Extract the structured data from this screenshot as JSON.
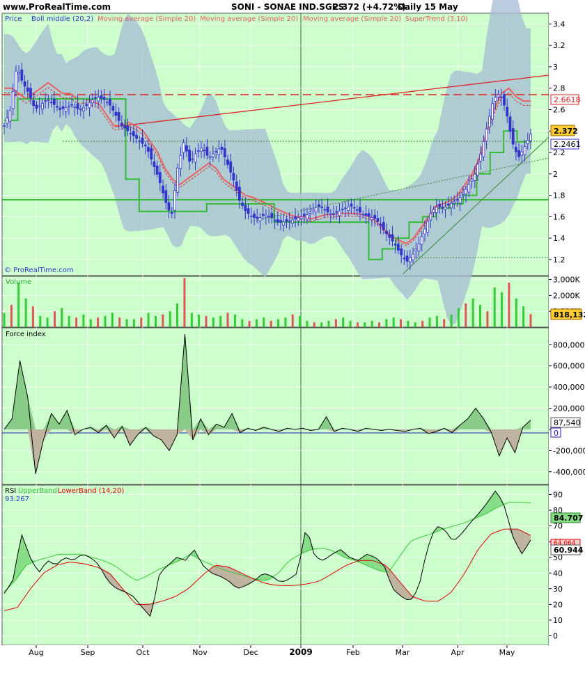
{
  "header": {
    "site": "www.ProRealTime.com",
    "instrument": "SONI - SONAE IND.SGPS",
    "quote": "2.372 (+4.72%)",
    "period": "Daily  15 May"
  },
  "colors": {
    "background": "#ccffcc",
    "price_candle": "#3333cc",
    "bollinger_band": "#a9bfd4",
    "moving_average": "#e86060",
    "supertrend": "#33bb33",
    "volume_up": "#33cc33",
    "volume_down": "#dd5555",
    "rsi_line": "#000000",
    "rsi_upper": "#33cc33",
    "rsi_lower": "#dd0000"
  },
  "price_panel": {
    "legend": [
      "Price",
      "Boll middle (20,2)",
      "Moving average (Simple 20)",
      "Moving average (Simple 20)",
      "Moving average (Simple 20)",
      "SuperTrend (3,10)"
    ],
    "watermark": "© ProRealTime.com",
    "last_price": "2.372",
    "value_2": "2.6618",
    "value_3": "2.2461"
  },
  "volume_panel": {
    "title": "Volume",
    "last_value": "818,132"
  },
  "force_panel": {
    "title": "Force index",
    "last_value": "87,540",
    "zero_label": "0"
  },
  "rsi_panel": {
    "title": "RSI",
    "upper_label": "UpperBand",
    "lower_label": "LowerBand (14,20)",
    "sub_value": "93.267",
    "value_upper": "84.707",
    "value_rsi": "60.944",
    "value_lower": "64.064"
  },
  "chart_data": [
    {
      "type": "line",
      "panel": "price",
      "title": "SONI - SONAE IND.SGPS",
      "x_labels": [
        "Aug",
        "Sep",
        "Oct",
        "Nov",
        "Dec",
        "2009",
        "Feb",
        "Mar",
        "Apr",
        "May"
      ],
      "y_ticks": [
        1.2,
        1.4,
        1.6,
        1.8,
        2,
        2.2,
        2.4,
        2.6,
        2.8,
        3,
        3.2,
        3.4
      ],
      "ylim": [
        1.05,
        3.5
      ],
      "series": [
        {
          "name": "Price",
          "values": [
            2.45,
            2.6,
            3.0,
            2.85,
            2.75,
            2.6,
            2.65,
            2.7,
            2.65,
            2.6,
            2.62,
            2.65,
            2.6,
            2.62,
            2.68,
            2.72,
            2.7,
            2.65,
            2.55,
            2.45,
            2.4,
            2.35,
            2.3,
            2.25,
            2.1,
            1.95,
            1.75,
            1.6,
            2.05,
            2.3,
            2.1,
            2.2,
            2.25,
            2.15,
            2.2,
            2.25,
            2.1,
            1.95,
            1.75,
            1.65,
            1.6,
            1.58,
            1.62,
            1.6,
            1.55,
            1.55,
            1.56,
            1.58,
            1.6,
            1.62,
            1.68,
            1.7,
            1.65,
            1.62,
            1.65,
            1.68,
            1.7,
            1.66,
            1.62,
            1.6,
            1.58,
            1.5,
            1.42,
            1.35,
            1.25,
            1.18,
            1.25,
            1.35,
            1.5,
            1.65,
            1.7,
            1.68,
            1.72,
            1.75,
            1.8,
            1.9,
            2.0,
            2.2,
            2.45,
            2.7,
            2.75,
            2.6,
            2.3,
            2.15,
            2.25,
            2.37
          ]
        },
        {
          "name": "Moving average (Simple 20)",
          "values": [
            2.8,
            2.8,
            2.75,
            2.7,
            2.75,
            2.8,
            2.85,
            2.8,
            2.75,
            2.75,
            2.7,
            2.7,
            2.68,
            2.65,
            2.55,
            2.45,
            2.45,
            2.48,
            2.45,
            2.4,
            2.3,
            2.2,
            2.05,
            1.95,
            1.9,
            1.95,
            2.0,
            2.05,
            2.1,
            2.05,
            1.95,
            1.9,
            1.85,
            1.8,
            1.78,
            1.75,
            1.72,
            1.68,
            1.65,
            1.62,
            1.6,
            1.6,
            1.58,
            1.6,
            1.62,
            1.62,
            1.63,
            1.63,
            1.63,
            1.62,
            1.6,
            1.55,
            1.48,
            1.42,
            1.38,
            1.35,
            1.4,
            1.5,
            1.6,
            1.7,
            1.72,
            1.75,
            1.8,
            1.9,
            2.0,
            2.15,
            2.4,
            2.6,
            2.75,
            2.8,
            2.72,
            2.68,
            2.68
          ]
        },
        {
          "name": "SuperTrend (3,10)",
          "values": [
            2.5,
            2.7,
            2.7,
            2.7,
            2.7,
            2.7,
            2.7,
            2.7,
            2.7,
            1.95,
            1.65,
            1.65,
            1.65,
            1.65,
            1.65,
            1.72,
            1.72,
            1.72,
            1.72,
            1.72,
            1.55,
            1.55,
            1.55,
            1.55,
            1.55,
            1.55,
            1.55,
            1.2,
            1.3,
            1.4,
            1.55,
            1.6,
            1.68,
            1.72,
            1.8,
            2.0,
            2.2,
            2.4,
            2.3,
            2.35
          ]
        }
      ],
      "reference_lines": [
        2.7,
        2.25,
        1.73,
        1.2
      ]
    },
    {
      "type": "bar",
      "panel": "volume",
      "title": "Volume",
      "y_ticks": [
        1000000,
        2000000,
        3000000
      ],
      "y_tick_labels": [
        "1,000K",
        "2,000K",
        "3,000K"
      ],
      "ylim": [
        0,
        3200000
      ],
      "series": [
        {
          "name": "Volume",
          "values": [
            900000,
            1400000,
            2800000,
            1800000,
            1300000,
            700000,
            600000,
            1000000,
            1200000,
            700000,
            600000,
            800000,
            500000,
            600000,
            700000,
            900000,
            600000,
            500000,
            500000,
            600000,
            900000,
            700000,
            800000,
            1000000,
            1500000,
            3100000,
            900000,
            800000,
            700000,
            600000,
            700000,
            900000,
            800000,
            500000,
            400000,
            500000,
            600000,
            400000,
            500000,
            600000,
            800000,
            700000,
            400000,
            300000,
            300000,
            400000,
            500000,
            600000,
            400000,
            300000,
            300000,
            400000,
            300000,
            500000,
            600000,
            500000,
            400000,
            300000,
            400000,
            600000,
            700000,
            500000,
            800000,
            1200000,
            1500000,
            1800000,
            1400000,
            1000000,
            2500000,
            2200000,
            2800000,
            1800000,
            1300000,
            818132
          ]
        }
      ]
    },
    {
      "type": "area",
      "panel": "force_index",
      "title": "Force index",
      "y_ticks": [
        -400000,
        -200000,
        0,
        200000,
        400000,
        600000,
        800000
      ],
      "y_tick_labels": [
        "-400,000",
        "-200,000",
        "0",
        "200,000",
        "400,000",
        "600,000",
        "800,000"
      ],
      "ylim": [
        -520000,
        960000
      ],
      "series": [
        {
          "name": "Force index",
          "values": [
            0,
            100000,
            650000,
            300000,
            -420000,
            -100000,
            150000,
            50000,
            180000,
            -50000,
            0,
            20000,
            -30000,
            40000,
            -80000,
            30000,
            -150000,
            -50000,
            20000,
            -60000,
            -100000,
            -200000,
            -50000,
            900000,
            -100000,
            100000,
            -50000,
            50000,
            20000,
            150000,
            -30000,
            10000,
            -10000,
            20000,
            0,
            -20000,
            10000,
            0,
            10000,
            -10000,
            0,
            120000,
            -20000,
            10000,
            0,
            -20000,
            10000,
            0,
            -10000,
            0,
            -10000,
            -20000,
            0,
            10000,
            -40000,
            -20000,
            10000,
            -30000,
            40000,
            100000,
            200000,
            100000,
            -30000,
            -250000,
            -80000,
            -220000,
            20000,
            87540
          ]
        }
      ]
    },
    {
      "type": "line",
      "panel": "rsi",
      "title": "RSI",
      "y_ticks": [
        0,
        10,
        20,
        30,
        40,
        50,
        60,
        70,
        80,
        90
      ],
      "ylim": [
        -6,
        96
      ],
      "series": [
        {
          "name": "RSI",
          "values": [
            27,
            35,
            65,
            50,
            40,
            48,
            45,
            50,
            48,
            52,
            50,
            45,
            35,
            30,
            28,
            25,
            18,
            12,
            40,
            45,
            50,
            48,
            55,
            45,
            40,
            38,
            35,
            30,
            32,
            35,
            40,
            38,
            34,
            36,
            40,
            70,
            50,
            48,
            52,
            55,
            50,
            48,
            52,
            50,
            45,
            30,
            25,
            22,
            30,
            55,
            70,
            68,
            60,
            65,
            72,
            78,
            85,
            93,
            82,
            62,
            52,
            61
          ]
        },
        {
          "name": "UpperBand",
          "values": [
            28,
            35,
            45,
            48,
            50,
            52,
            52,
            52,
            50,
            48,
            45,
            40,
            35,
            38,
            42,
            45,
            48,
            52,
            48,
            45,
            42,
            40,
            38,
            36,
            35,
            40,
            48,
            52,
            55,
            56,
            54,
            50,
            48,
            45,
            42,
            40,
            50,
            60,
            63,
            65,
            68,
            70,
            72,
            75,
            78,
            82,
            85,
            85,
            84.7
          ]
        },
        {
          "name": "LowerBand",
          "values": [
            16,
            18,
            30,
            40,
            45,
            47,
            46,
            44,
            40,
            30,
            20,
            20,
            22,
            25,
            30,
            38,
            45,
            44,
            40,
            36,
            33,
            32,
            32,
            33,
            35,
            40,
            45,
            48,
            48,
            45,
            35,
            25,
            22,
            22,
            28,
            40,
            55,
            65,
            68,
            68,
            64
          ]
        }
      ]
    }
  ]
}
